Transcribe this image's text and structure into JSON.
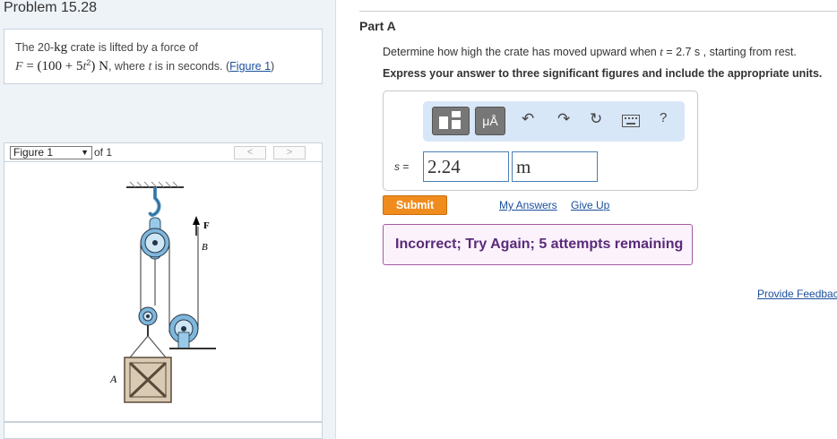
{
  "problem": {
    "title": "Problem 15.28",
    "text_1": "The 20-",
    "text_kg": "kg",
    "text_2": " crate is lifted by a force of",
    "formula_F": "F",
    "formula_eq": " = (100 + 5",
    "formula_t": "t",
    "formula_sq": "2",
    "formula_close": ") N",
    "text_3": ", where ",
    "text_t": "t",
    "text_4": " is in seconds. (",
    "figure_link": "Figure 1",
    "text_5": ")"
  },
  "figure_nav": {
    "selected": "Figure 1",
    "of_label": "of 1",
    "prev_label": "<",
    "next_label": ">"
  },
  "figure_labels": {
    "F": "F",
    "B": "B",
    "A": "A"
  },
  "part": {
    "title": "Part A",
    "question_1": "Determine how high the crate has moved upward when ",
    "question_t": "t",
    "question_2": " = 2.7  s , starting from rest.",
    "instruction": "Express your answer to three significant figures and include the appropriate units."
  },
  "toolbar": {
    "units_label": "μÅ",
    "help_label": "?",
    "icons": [
      "templates-icon",
      "units-icon",
      "undo-icon",
      "redo-icon",
      "reset-icon",
      "keyboard-icon",
      "help-icon"
    ]
  },
  "answer": {
    "variable": "s",
    "equals": " =",
    "value": "2.24",
    "unit": "m"
  },
  "actions": {
    "submit": "Submit",
    "my_answers": "My Answers",
    "give_up": "Give Up",
    "provide_feedback": "Provide Feedback"
  },
  "feedback": {
    "message": "Incorrect; Try Again; 5 attempts remaining"
  },
  "colors": {
    "submit": "#f08c1e",
    "feedback_border": "#a55aa5",
    "feedback_text": "#5a2a7a",
    "link": "#1a4f9c",
    "toolbar_bg": "#d7e7f7"
  }
}
